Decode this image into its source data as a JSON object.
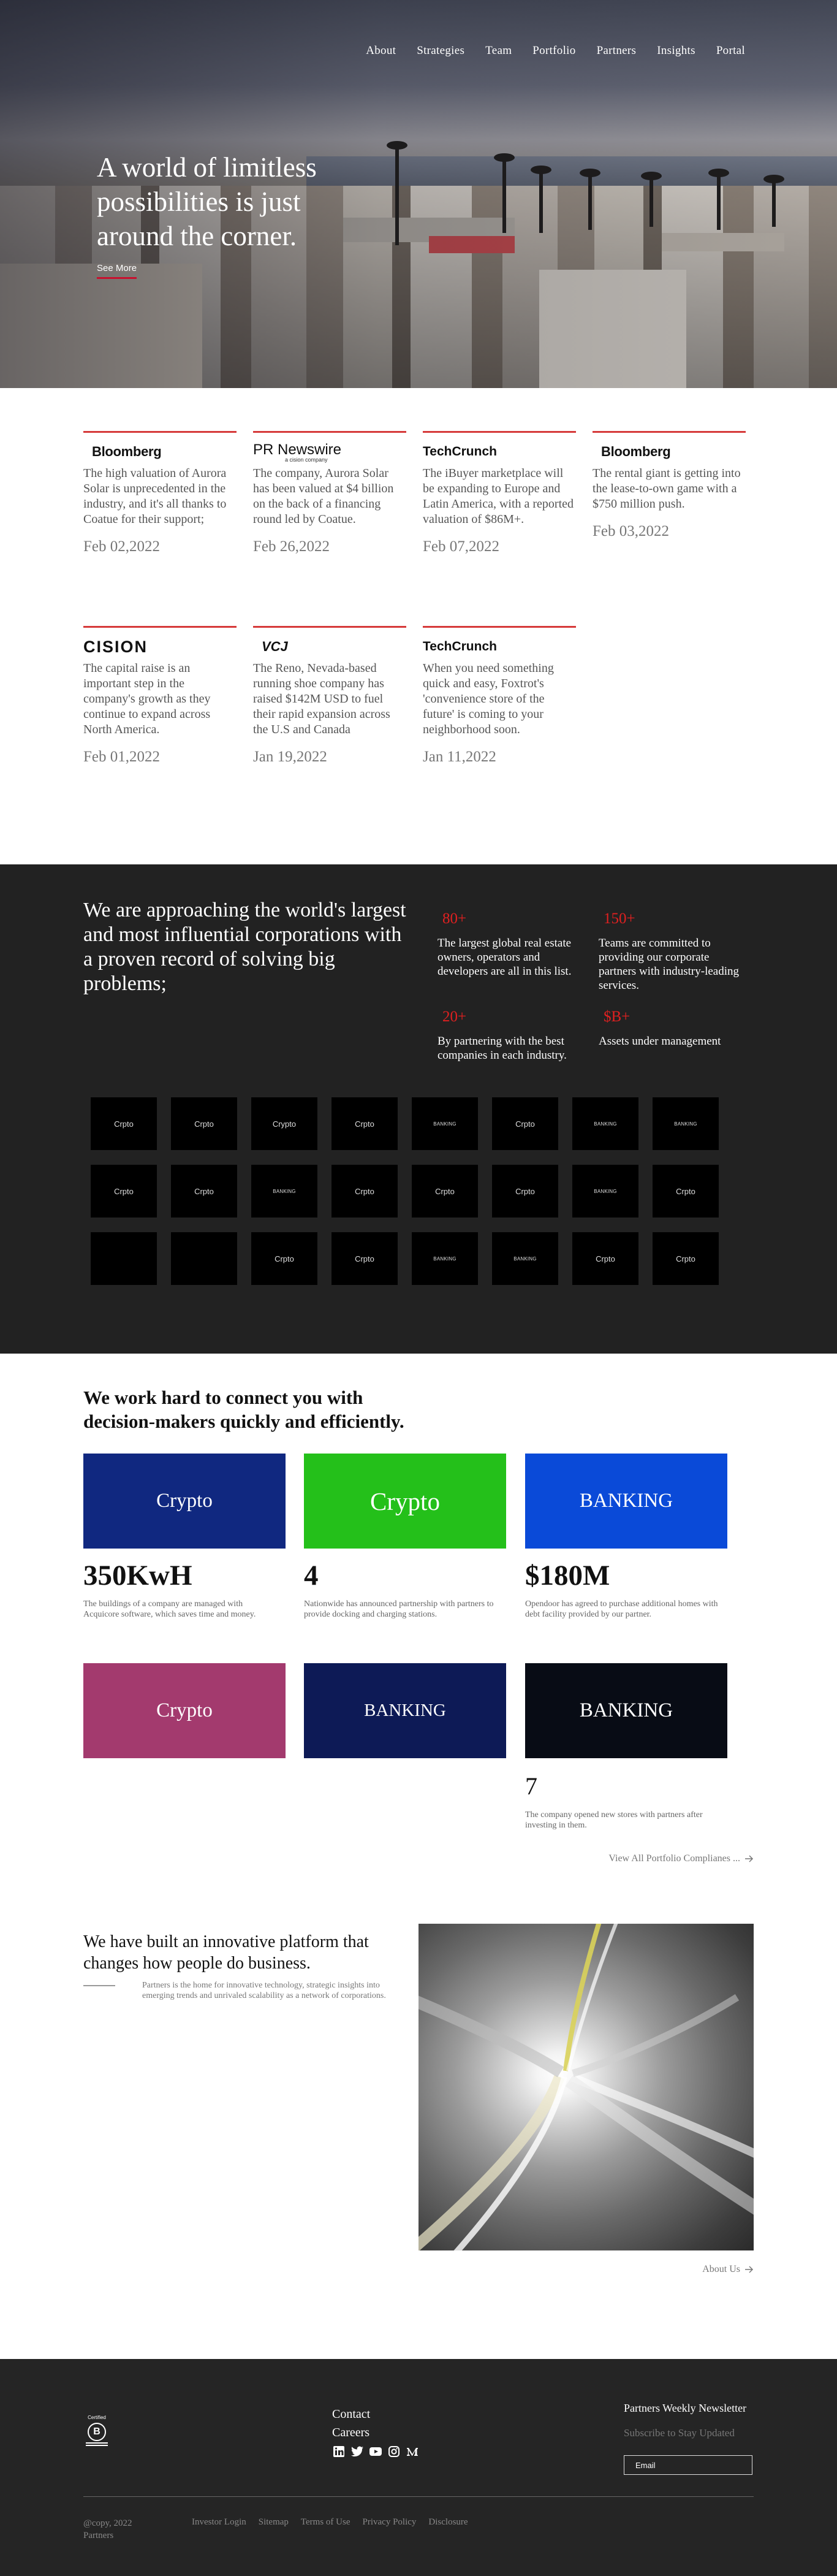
{
  "nav": [
    "About",
    "Strategies",
    "Team",
    "Portfolio",
    "Partners",
    "Insights",
    "Portal"
  ],
  "hero": {
    "headline": "A world of limitless possibilities is just around the corner.",
    "cta": "See More"
  },
  "press": [
    {
      "logo": "Bloomberg",
      "text": "The high valuation of Aurora Solar is unprecedented in the industry, and it's all thanks to Coatue for their support;",
      "date": "Feb 02,2022"
    },
    {
      "logo": "PR Newswire",
      "logo_sub": "a cision company",
      "text": "The company, Aurora Solar has been valued at $4 billion on the back of a financing round led by Coatue.",
      "date": "Feb 26,2022"
    },
    {
      "logo": "TechCrunch",
      "text": "The iBuyer marketplace will be expanding to Europe and Latin America, with a reported valuation of $86M+.",
      "date": "Feb 07,2022"
    },
    {
      "logo": "Bloomberg",
      "text": "The rental giant is getting into the lease-to-own game with a $750 million push.",
      "date": "Feb 03,2022"
    },
    {
      "logo": "CISION",
      "text": "The capital raise is an important step in the company's growth as they continue to expand across North America.",
      "date": "Feb 01,2022"
    },
    {
      "logo": "VCJ",
      "text": "The Reno, Nevada-based running shoe company has raised $142M USD to fuel their rapid expansion across the U.S and Canada",
      "date": "Jan 19,2022"
    },
    {
      "logo": "TechCrunch",
      "text": "When you need something quick and easy, Foxtrot's 'convenience store of the future' is coming to your neighborhood soon.",
      "date": "Jan 11,2022"
    }
  ],
  "stats": {
    "headline": "We are approaching the world's largest and most influential corporations with a proven record of solving big problems;",
    "items": [
      {
        "num": "80+",
        "text": "The largest global real estate owners, operators and developers are all in this list."
      },
      {
        "num": "150+",
        "text": "Teams are committed to providing our corporate partners with industry-leading services."
      },
      {
        "num": "20+",
        "text": "By partnering with the best companies in each industry."
      },
      {
        "num": "$B+",
        "text": "Assets under management"
      }
    ]
  },
  "tiles": [
    "Crpto",
    "Crpto",
    "Crypto",
    "Crpto",
    "BANKING",
    "Crpto",
    "BANKING",
    "BANKING",
    "Crpto",
    "Crpto",
    "BANKING",
    "Crpto",
    "Crpto",
    "Crpto",
    "BANKING",
    "Crpto",
    "",
    "",
    "Crpto",
    "Crpto",
    "BANKING",
    "BANKING",
    "Crpto",
    "Crpto"
  ],
  "connect": {
    "headline": "We work hard to connect you with decision-makers quickly and efficiently.",
    "cards": [
      {
        "label": "Crypto",
        "value": "350KwH",
        "desc": "The buildings of a company are managed with Acquicore software, which saves time and money.",
        "color": "#102880"
      },
      {
        "label": "Crypto",
        "value": "4",
        "desc": "Nationwide has announced partnership with partners to provide docking and charging stations.",
        "color": "#24c01a"
      },
      {
        "label": "BANKING",
        "value": "$180M",
        "desc": "Opendoor has agreed to purchase additional homes with debt facility provided by our partner.",
        "color": "#0a4ad8"
      },
      {
        "label": "Crypto",
        "value": "",
        "desc": "",
        "color": "#a33a6e"
      },
      {
        "label": "BANKING",
        "value": "",
        "desc": "",
        "color": "#0d1a56"
      },
      {
        "label": "BANKING",
        "value": "7",
        "desc": "The company opened new stores with partners after investing in them.",
        "color": "#080c15"
      }
    ],
    "link": "View All Portfolio Complianes ..."
  },
  "platform": {
    "headline": "We have built an innovative platform that changes how people do business.",
    "desc": "Partners is the home for innovative technology, strategic insights into emerging trends and unrivaled scalability as a network of corporations.",
    "link": "About Us"
  },
  "footer": {
    "badge_top": "Certified",
    "badge_letter": "B",
    "links": [
      "Contact",
      "Careers"
    ],
    "social": [
      "linkedin-icon",
      "twitter-icon",
      "youtube-icon",
      "instagram-icon",
      "medium-icon"
    ],
    "newsletter_title": "Partners Weekly Newsletter",
    "newsletter_sub": "Subscribe to Stay Updated",
    "email_placeholder": "Email",
    "copyright": "@copy, 2022",
    "company": "Partners",
    "bottom_links": [
      "Investor Login",
      "Sitemap",
      "Terms of Use",
      "Privacy Policy",
      "Disclosure"
    ]
  }
}
